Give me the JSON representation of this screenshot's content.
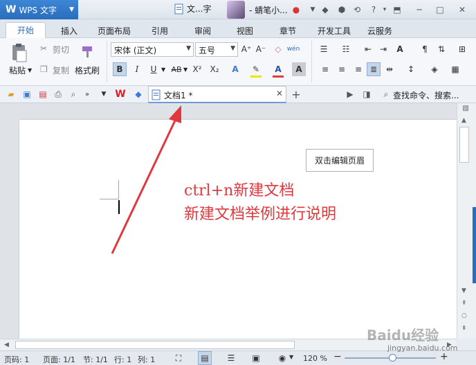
{
  "titlebar": {
    "app_name": "WPS 文字",
    "doc_tab": "文...字",
    "user": "- 蜻笔小...",
    "help": "?"
  },
  "menu": [
    "开始",
    "插入",
    "页面布局",
    "引用",
    "审阅",
    "视图",
    "章节",
    "开发工具",
    "云服务"
  ],
  "ribbon": {
    "paste": "粘贴",
    "cut": "剪切",
    "copy": "复制",
    "format_painter": "格式刷",
    "font_name": "宋体 (正文)",
    "font_size": "五号",
    "bold": "B",
    "italic": "I",
    "underline": "U",
    "strike": "AB",
    "superscript": "X²",
    "subscript": "X₂",
    "grow": "A⁺",
    "shrink": "A⁻",
    "pinyin": "wén"
  },
  "quickbar": {
    "doc_tab_label": "文档1 *",
    "search_placeholder": "查找命令、搜索..."
  },
  "document": {
    "header_hint": "双击编辑页眉",
    "annotation_line1": "ctrl+n新建文档",
    "annotation_line2": "新建文档举例进行说明"
  },
  "status": {
    "page_code": "页码: 1",
    "pages": "页面: 1/1",
    "section": "节: 1/1",
    "row": "行: 1",
    "col": "列: 1",
    "zoom": "120 %"
  },
  "watermark": {
    "site": "jingyan.baidu.com",
    "brand": "Baidu经验"
  },
  "colors": {
    "accent": "#2a6dbd",
    "annotation": "#e0383d"
  }
}
